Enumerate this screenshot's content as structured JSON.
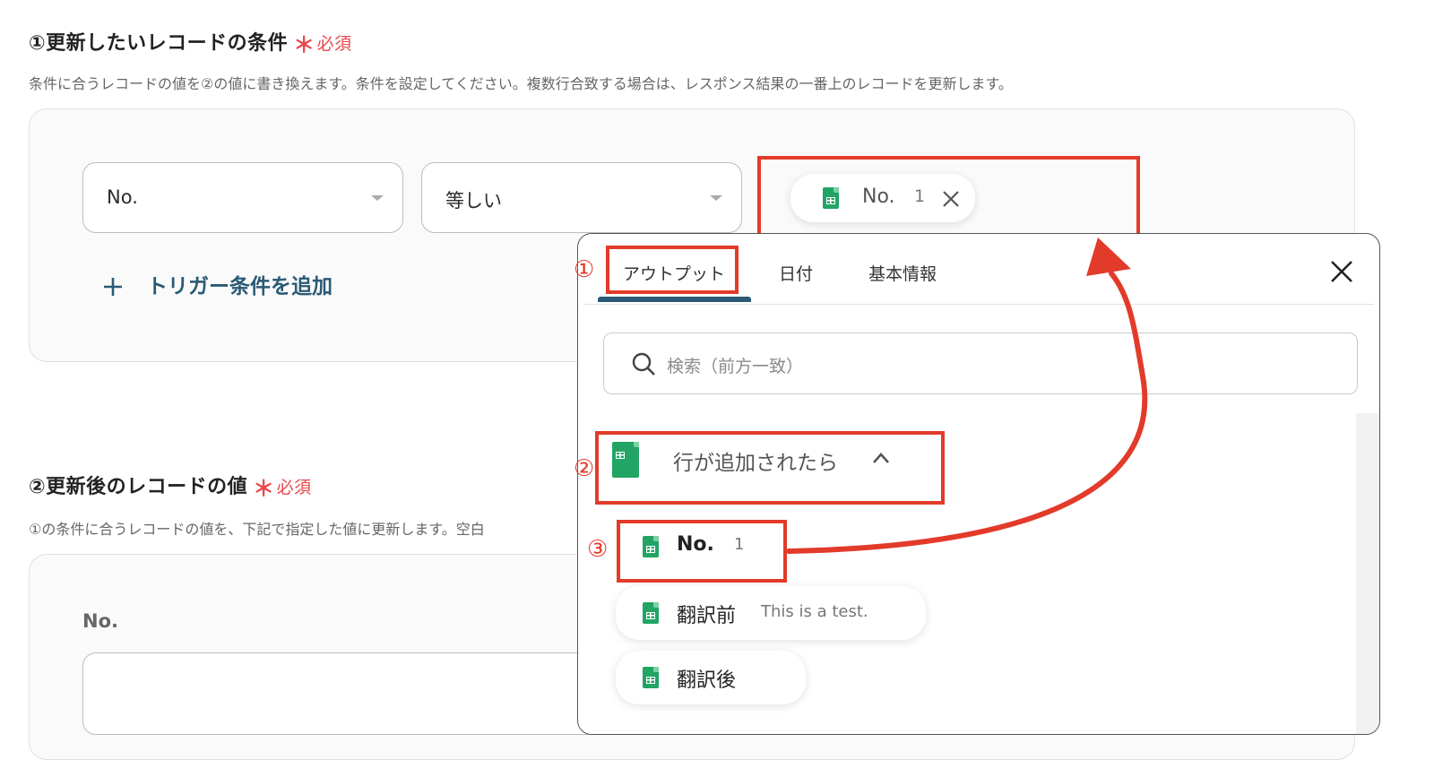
{
  "section1": {
    "title": "①更新したいレコードの条件",
    "required_star": "＊",
    "required_label": "必須",
    "description": "条件に合うレコードの値を②の値に書き換えます。条件を設定してください。複数行合致する場合は、レスポンス結果の一番上のレコードを更新します。",
    "field_select": "No.",
    "operator_select": "等しい",
    "value_chip": {
      "label": "No.",
      "value": "1"
    },
    "add_condition": "トリガー条件を追加"
  },
  "section2": {
    "title": "②更新後のレコードの値",
    "required_star": "＊",
    "required_label": "必須",
    "description": "①の条件に合うレコードの値を、下記で指定した値に更新します。空白",
    "field_label": "No."
  },
  "popup": {
    "tabs": [
      "アウトプット",
      "日付",
      "基本情報"
    ],
    "search_placeholder": "検索（前方一致）",
    "group_title": "行が追加されたら",
    "items": [
      {
        "label": "No.",
        "value": "1"
      },
      {
        "label": "翻訳前",
        "value": "This is a test."
      },
      {
        "label": "翻訳後",
        "value": ""
      }
    ]
  },
  "annotations": [
    "①",
    "②",
    "③"
  ],
  "colors": {
    "accent_red": "#e23b2a",
    "required_red": "#e8484e",
    "tab_underline": "#2a5a74",
    "add_link": "#2a5a74",
    "sheet_green": "#21a464"
  },
  "icons": [
    "sheet-icon",
    "close-icon",
    "search-icon",
    "plus-icon",
    "chevron-up-icon",
    "chevron-down-icon"
  ]
}
